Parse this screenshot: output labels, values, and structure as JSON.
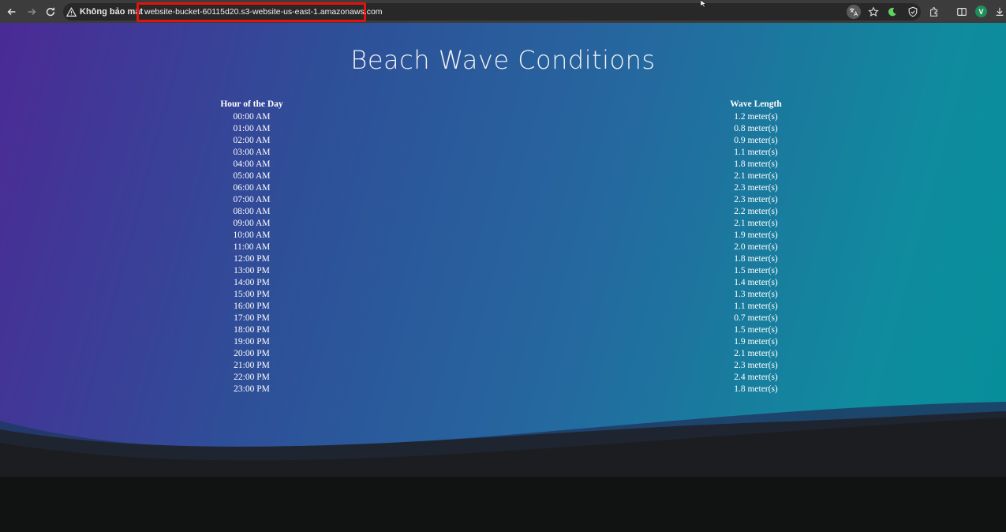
{
  "browser": {
    "security_label": "Không bảo mật",
    "url": "website-bucket-60115d20.s3-website-us-east-1.amazonaws.com",
    "profile_initial": "V",
    "highlight_color": "#e3120c"
  },
  "page": {
    "title": "Beach Wave Conditions",
    "table": {
      "headers": [
        "Hour of the Day",
        "Wave Length"
      ],
      "rows": [
        [
          "00:00 AM",
          "1.2 meter(s)"
        ],
        [
          "01:00 AM",
          "0.8 meter(s)"
        ],
        [
          "02:00 AM",
          "0.9 meter(s)"
        ],
        [
          "03:00 AM",
          "1.1 meter(s)"
        ],
        [
          "04:00 AM",
          "1.8 meter(s)"
        ],
        [
          "05:00 AM",
          "2.1 meter(s)"
        ],
        [
          "06:00 AM",
          "2.3 meter(s)"
        ],
        [
          "07:00 AM",
          "2.3 meter(s)"
        ],
        [
          "08:00 AM",
          "2.2 meter(s)"
        ],
        [
          "09:00 AM",
          "2.1 meter(s)"
        ],
        [
          "10:00 AM",
          "1.9 meter(s)"
        ],
        [
          "11:00 AM",
          "2.0 meter(s)"
        ],
        [
          "12:00 PM",
          "1.8 meter(s)"
        ],
        [
          "13:00 PM",
          "1.5 meter(s)"
        ],
        [
          "14:00 PM",
          "1.4 meter(s)"
        ],
        [
          "15:00 PM",
          "1.3 meter(s)"
        ],
        [
          "16:00 PM",
          "1.1 meter(s)"
        ],
        [
          "17:00 PM",
          "0.7 meter(s)"
        ],
        [
          "18:00 PM",
          "1.5 meter(s)"
        ],
        [
          "19:00 PM",
          "1.9 meter(s)"
        ],
        [
          "20:00 PM",
          "2.1 meter(s)"
        ],
        [
          "21:00 PM",
          "2.3 meter(s)"
        ],
        [
          "22:00 PM",
          "2.4 meter(s)"
        ],
        [
          "23:00 PM",
          "1.8 meter(s)"
        ]
      ]
    }
  },
  "icons": [
    "back-icon",
    "forward-icon",
    "reload-icon",
    "warning-icon",
    "translate-icon",
    "star-icon",
    "moon-icon",
    "shield-icon",
    "extensions-icon",
    "sidepanel-icon",
    "download-icon"
  ]
}
